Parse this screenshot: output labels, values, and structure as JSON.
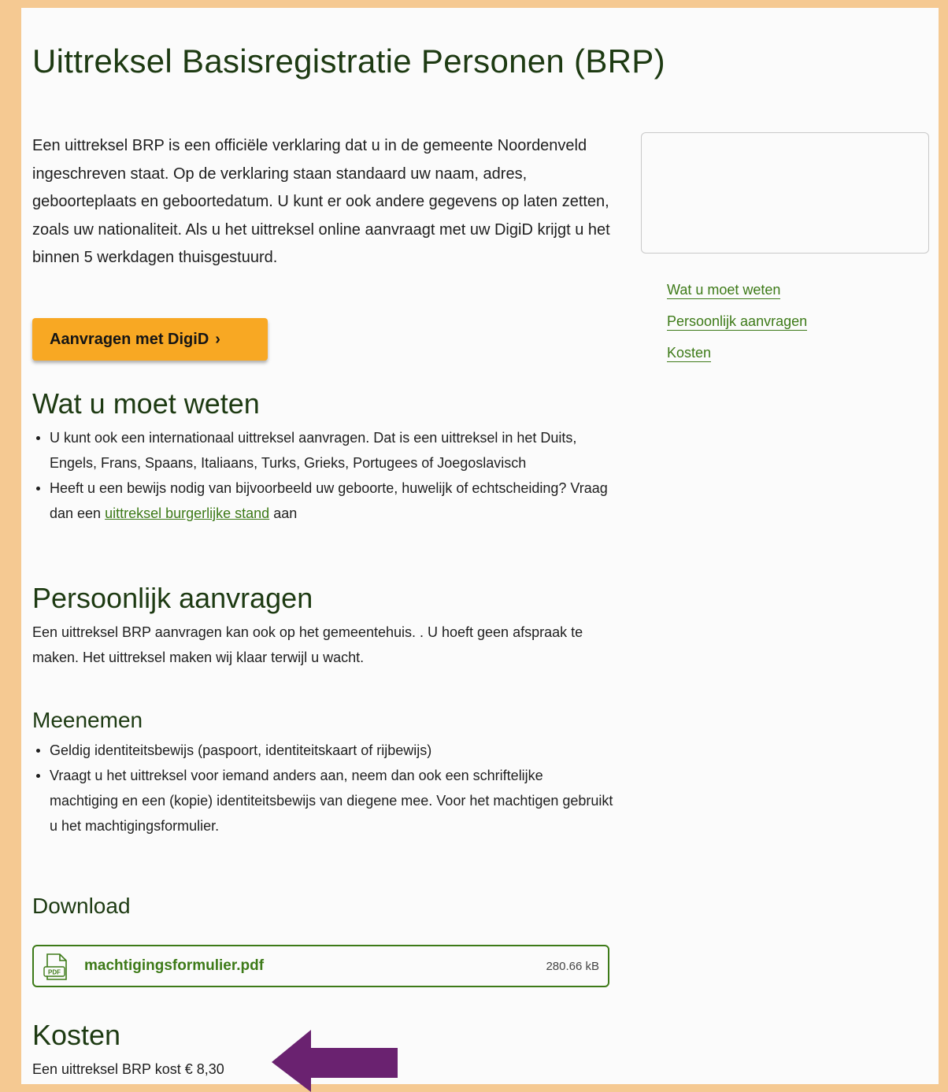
{
  "page": {
    "title": "Uittreksel Basisregistratie Personen (BRP)",
    "intro": "Een uittreksel BRP is een officiële verklaring dat u in de gemeente Noordenveld ingeschreven staat. Op de verklaring staan standaard uw naam, adres, geboorteplaats en geboortedatum. U kunt er ook andere gegevens op laten zetten, zoals uw nationaliteit. Als u het uittreksel online aanvraagt met uw DigiD krijgt u het binnen 5 werkdagen thuisgestuurd.",
    "cta_label": "Aanvragen met DigiD",
    "cta_chevron": "›"
  },
  "toc": {
    "items": [
      "Wat u moet weten",
      "Persoonlijk aanvragen",
      "Kosten"
    ]
  },
  "wat": {
    "heading": "Wat u moet weten",
    "bullet1": "U kunt ook een internationaal uittreksel aanvragen. Dat is een uittreksel in het Duits, Engels, Frans, Spaans, Italiaans, Turks, Grieks, Portugees of Joegoslavisch",
    "bullet2_before": "Heeft u een bewijs nodig van bijvoorbeeld uw geboorte, huwelijk of echtscheiding? Vraag dan een ",
    "bullet2_link": "uittreksel burgerlijke stand",
    "bullet2_after": " aan"
  },
  "persoonlijk": {
    "heading": "Persoonlijk aanvragen",
    "text": "Een uittreksel BRP aanvragen kan ook op het gemeentehuis. . U hoeft geen afspraak te maken. Het uittreksel maken wij klaar terwijl u wacht."
  },
  "meenemen": {
    "heading": "Meenemen",
    "items": [
      "Geldig identiteitsbewijs (paspoort, identiteitskaart of rijbewijs)",
      "Vraagt u het uittreksel voor iemand anders aan, neem dan ook een schriftelijke machtiging en een (kopie) identiteitsbewijs van diegene mee. Voor het machtigen gebruikt u het machtigingsformulier."
    ]
  },
  "download": {
    "heading": "Download",
    "file_name": "machtigingsformulier.pdf",
    "file_size": "280.66 kB",
    "icon_label": "PDF"
  },
  "kosten": {
    "heading": "Kosten",
    "text": "Een uittreksel BRP kost € 8,30"
  },
  "colors": {
    "accent_green": "#3d7a18",
    "heading_green": "#1d3a12",
    "cta_orange": "#f8a823",
    "frame_orange": "#f5c992",
    "arrow_purple": "#6a2270"
  }
}
